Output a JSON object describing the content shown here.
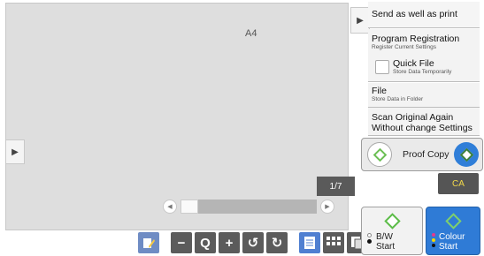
{
  "preview": {
    "paper_size": "A4",
    "page_counter": "1/7",
    "left_handle_icon": "▶",
    "scroll_position": 0.0
  },
  "panel": {
    "handle_icon": "▶",
    "send_print": {
      "title": "Send as well as print"
    },
    "program_registration": {
      "title": "Program Registration",
      "subtitle": "Register Current Settings"
    },
    "quick_file": {
      "title": "Quick File",
      "subtitle": "Store Data Temporarily",
      "checked": false
    },
    "file": {
      "title": "File",
      "subtitle": "Store Data in Folder"
    },
    "scan_again": {
      "title": "Scan Original Again Without change Settings"
    }
  },
  "proof_copy": {
    "label": "Proof Copy"
  },
  "ca": {
    "label": "CA"
  },
  "bw_start": {
    "line1": "B/W",
    "line2": "Start"
  },
  "colour_start": {
    "line1": "Colour",
    "line2": "Start"
  },
  "toolbar": {
    "zoom_out": "−",
    "zoom_icon": "Q",
    "zoom_in": "+",
    "rotate_left": "↺",
    "rotate_right": "↻"
  },
  "colors": {
    "accent_blue": "#2f7bd6",
    "start_green": "#5cbc48",
    "ca_text": "#f2d84a"
  }
}
